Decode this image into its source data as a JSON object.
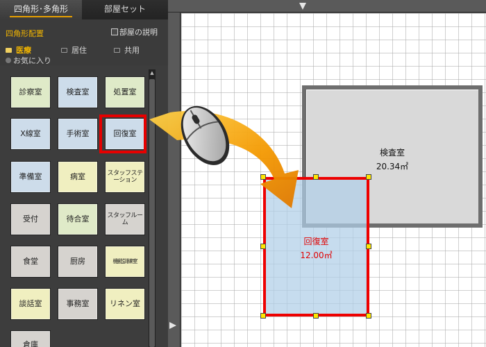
{
  "tabs": [
    {
      "label": "四角形･多角形",
      "active": true
    },
    {
      "label": "部屋セット",
      "active": false
    }
  ],
  "panel": {
    "section_title": "四角形配置",
    "description_checkbox": {
      "label": "部屋の説明",
      "checked": false
    },
    "categories": [
      {
        "label": "医療",
        "active": true
      },
      {
        "label": "居住",
        "active": false
      },
      {
        "label": "共用",
        "active": false
      }
    ],
    "favorites_label": "お気に入り",
    "tiles": [
      {
        "label": "診察室",
        "color": "green"
      },
      {
        "label": "検査室",
        "color": "blue"
      },
      {
        "label": "処置室",
        "color": "green"
      },
      {
        "label": "X線室",
        "color": "blue"
      },
      {
        "label": "手術室",
        "color": "blue"
      },
      {
        "label": "回復室",
        "color": "blue",
        "selected": true
      },
      {
        "label": "準備室",
        "color": "blue"
      },
      {
        "label": "病室",
        "color": "yellow"
      },
      {
        "label": "スタッフステーション",
        "color": "yellow"
      },
      {
        "label": "受付",
        "color": "gray"
      },
      {
        "label": "待合室",
        "color": "green"
      },
      {
        "label": "スタッフルーム",
        "color": "gray"
      },
      {
        "label": "食堂",
        "color": "gray"
      },
      {
        "label": "厨房",
        "color": "gray"
      },
      {
        "label": "機能訓練室",
        "color": "yellow"
      },
      {
        "label": "談話室",
        "color": "yellow"
      },
      {
        "label": "事務室",
        "color": "gray"
      },
      {
        "label": "リネン室",
        "color": "yellow"
      },
      {
        "label": "倉庫",
        "color": "gray"
      }
    ]
  },
  "canvas": {
    "rooms": [
      {
        "name": "検査室",
        "area": "20.34㎡"
      },
      {
        "name": "回復室",
        "area": "12.00㎡",
        "selected": true
      }
    ]
  },
  "colors": {
    "accent": "#f0b400",
    "selection": "#e60000",
    "handle": "#ffe600",
    "arrow": "#f39800"
  },
  "icons": [
    "folder-icon",
    "star-icon",
    "mouse-icon",
    "drag-arrow-icon",
    "ruler-marker-icon"
  ]
}
